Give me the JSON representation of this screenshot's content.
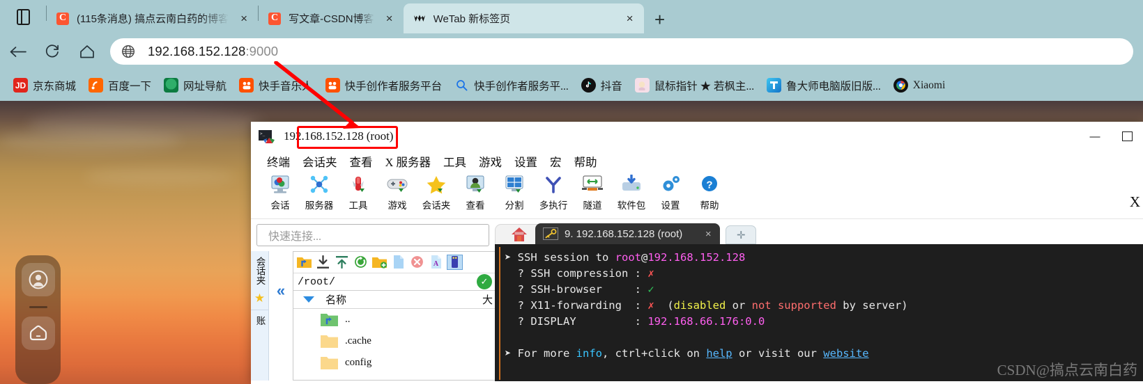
{
  "browser": {
    "tab_list_icon": "tabs-icon",
    "tabs": [
      {
        "title": "(115条消息) 搞点云南白药的博客",
        "favicon": "csdn-icon",
        "close": "×",
        "active": false
      },
      {
        "title": "写文章-CSDN博客",
        "favicon": "csdn-icon",
        "close": "×",
        "active": false
      },
      {
        "title": "WeTab 新标签页",
        "favicon": "wetab-icon",
        "close": "×",
        "active": true
      }
    ],
    "new_tab_label": "+",
    "toolbar": {
      "back_icon": "back-arrow-icon",
      "reload_icon": "reload-icon",
      "home_icon": "home-icon",
      "site_icon": "globe-icon",
      "url_main": "192.168.152.128",
      "url_dim": ":9000",
      "url_full": "192.168.152.128:9000"
    },
    "bookmarks": [
      {
        "label": "京东商城",
        "icon": "jd-icon",
        "glyph": "JD"
      },
      {
        "label": "百度一下",
        "icon": "baidu-icon",
        "glyph": ""
      },
      {
        "label": "网址导航",
        "icon": "hao123-icon",
        "glyph": ""
      },
      {
        "label": "快手音乐人",
        "icon": "kuaishou-icon",
        "glyph": ""
      },
      {
        "label": "快手创作者服务平台",
        "icon": "kuaishou-icon",
        "glyph": ""
      },
      {
        "label": "快手创作者服务平...",
        "icon": "search-icon",
        "glyph": "🔍"
      },
      {
        "label": "抖音",
        "icon": "douyin-icon",
        "glyph": "♪"
      },
      {
        "label": "鼠标指针 ★ 若枫主...",
        "icon": "mouse-pointer-icon",
        "glyph": ""
      },
      {
        "label": "鲁大师电脑版旧版...",
        "icon": "ludashi-icon",
        "glyph": ""
      },
      {
        "label": "Xiaomi",
        "icon": "xiaomi-icon",
        "glyph": ""
      }
    ]
  },
  "desktop": {
    "dock": {
      "account_icon": "account-avatar-icon",
      "home_icon": "home-rounded-icon"
    }
  },
  "moba": {
    "title_host": "192.168.152.128",
    "title_user": "(root)",
    "app_icon": "mobaxterm-icon",
    "window_controls": {
      "minimize": "—",
      "maximize": "▢"
    },
    "menu": [
      "终端",
      "会话夹",
      "查看",
      "X 服务器",
      "工具",
      "游戏",
      "设置",
      "宏",
      "帮助"
    ],
    "toolbar_items": [
      {
        "label": "会话",
        "icon": "session-icon"
      },
      {
        "label": "服务器",
        "icon": "servers-icon"
      },
      {
        "label": "工具",
        "icon": "tools-icon"
      },
      {
        "label": "游戏",
        "icon": "games-icon"
      },
      {
        "label": "会话夹",
        "icon": "sessions-folder-icon"
      },
      {
        "label": "查看",
        "icon": "view-icon"
      },
      {
        "label": "分割",
        "icon": "split-icon"
      },
      {
        "label": "多执行",
        "icon": "multiexec-icon"
      },
      {
        "label": "隧道",
        "icon": "tunneling-icon"
      },
      {
        "label": "软件包",
        "icon": "packages-icon"
      },
      {
        "label": "设置",
        "icon": "settings-icon"
      },
      {
        "label": "帮助",
        "icon": "help-icon"
      }
    ],
    "quick_connect_placeholder": "快速连接...",
    "vertical_tabs": [
      "会话夹",
      "★",
      "账"
    ],
    "collapse_icon": "collapse-chevrons-icon",
    "file_browser": {
      "toolbar_icons": [
        "up-folder-icon",
        "download-icon",
        "upload-icon",
        "refresh-icon",
        "new-folder-icon",
        "new-file-icon",
        "delete-icon",
        "text-mode-icon",
        "terminal-mode-icon"
      ],
      "path": "/root/",
      "path_ok": "✓",
      "columns": {
        "name": "名称",
        "size": "大"
      },
      "rows": [
        {
          "name": "..",
          "icon": "parent-folder-icon"
        },
        {
          "name": ".cache",
          "icon": "folder-icon"
        },
        {
          "name": "config",
          "icon": "folder-icon"
        }
      ]
    },
    "terminal_tabs": {
      "home_icon": "home-tab-icon",
      "active_label": "9. 192.168.152.128 (root)",
      "active_icon": "key-icon",
      "close": "×",
      "add": "✛"
    },
    "terminal_lines": [
      {
        "parts": [
          {
            "t": "➤ ",
            "c": "c-w"
          },
          {
            "t": "SSH session to ",
            "c": "c-w"
          },
          {
            "t": "root",
            "c": "c-mag"
          },
          {
            "t": "@",
            "c": "c-w"
          },
          {
            "t": "192.168.152.128",
            "c": "c-mag"
          }
        ]
      },
      {
        "parts": [
          {
            "t": "  ? SSH compression : ",
            "c": "c-w"
          },
          {
            "t": "✗",
            "c": "c-red"
          }
        ]
      },
      {
        "parts": [
          {
            "t": "  ? SSH-browser     : ",
            "c": "c-w"
          },
          {
            "t": "✓",
            "c": "c-grn"
          }
        ]
      },
      {
        "parts": [
          {
            "t": "  ? X11-forwarding  : ",
            "c": "c-w"
          },
          {
            "t": "✗",
            "c": "c-red"
          },
          {
            "t": "  (",
            "c": "c-w"
          },
          {
            "t": "disabled",
            "c": "c-yel"
          },
          {
            "t": " or ",
            "c": "c-w"
          },
          {
            "t": "not supported",
            "c": "c-sal"
          },
          {
            "t": " by server)",
            "c": "c-w"
          }
        ]
      },
      {
        "parts": [
          {
            "t": "  ? DISPLAY         : ",
            "c": "c-w"
          },
          {
            "t": "192.168.66.176:0.0",
            "c": "c-mag"
          }
        ]
      },
      {
        "parts": [
          {
            "t": " ",
            "c": "c-w"
          }
        ]
      },
      {
        "parts": [
          {
            "t": "➤ ",
            "c": "c-w"
          },
          {
            "t": "For more ",
            "c": "c-w"
          },
          {
            "t": "info",
            "c": "c-cy"
          },
          {
            "t": ", ctrl+click on ",
            "c": "c-w"
          },
          {
            "t": "help",
            "c": "lnk"
          },
          {
            "t": " or visit our ",
            "c": "c-w"
          },
          {
            "t": "website",
            "c": "lnk"
          }
        ]
      }
    ],
    "watermark": "CSDN@搞点云南白药"
  },
  "annotations": {
    "red_arrow": "red-pointer-arrow",
    "red_box_target": "192.168.152.128",
    "close_x_glyph": "X"
  },
  "colors": {
    "browser_chrome": "#a9cbd1",
    "active_tab": "#cfe5e8",
    "accent_red": "#ff0000",
    "terminal_bg": "#1e1e1e",
    "magenta": "#ff5ff0",
    "green_ok": "#30c35a",
    "red_no": "#ff5555"
  }
}
